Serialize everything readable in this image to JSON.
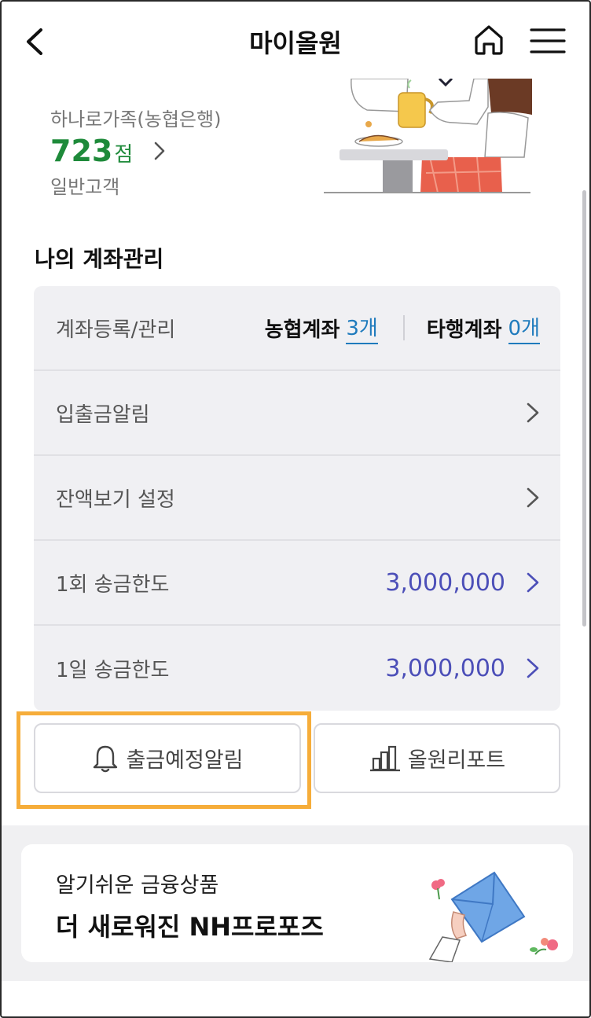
{
  "header": {
    "title": "마이올원"
  },
  "grade": {
    "program": "하나로가족(농협은행)",
    "score": "723",
    "score_unit": "점",
    "level": "일반고객"
  },
  "accounts": {
    "section_title": "나의 계좌관리",
    "register": {
      "label": "계좌등록/관리",
      "nh_label": "농협계좌",
      "nh_count": "3개",
      "other_label": "타행계좌",
      "other_count": "0개"
    },
    "rows": [
      {
        "label": "입출금알림",
        "value": ""
      },
      {
        "label": "잔액보기 설정",
        "value": ""
      },
      {
        "label": "1회 송금한도",
        "value": "3,000,000"
      },
      {
        "label": "1일 송금한도",
        "value": "3,000,000"
      }
    ]
  },
  "actions": {
    "alert_label": "출금예정알림",
    "report_label": "올원리포트"
  },
  "promo": {
    "subtitle": "알기쉬운 금융상품",
    "title": "더 새로워진 NH프로포즈"
  },
  "colors": {
    "score_green": "#1e8a3a",
    "amount_purple": "#4c4fb8",
    "count_blue": "#1f7bbd",
    "highlight_orange": "#f6ad3a"
  },
  "icons": [
    "back-arrow-icon",
    "home-icon",
    "hamburger-menu-icon",
    "chevron-right-icon",
    "bell-icon",
    "bar-chart-icon"
  ]
}
